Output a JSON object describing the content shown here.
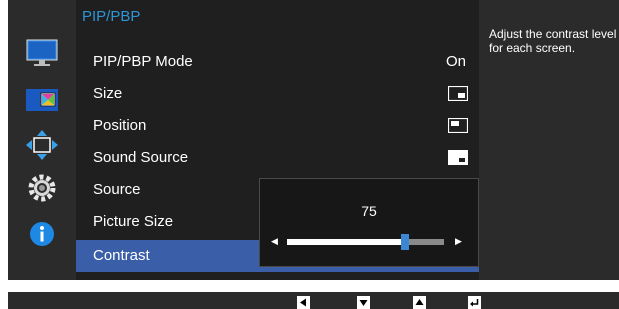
{
  "menu": {
    "title": "PIP/PBP",
    "items": [
      {
        "label": "PIP/PBP Mode",
        "value": "On",
        "icon": null
      },
      {
        "label": "Size",
        "value": "",
        "icon": "pip-size-icon"
      },
      {
        "label": "Position",
        "value": "",
        "icon": "pip-position-icon"
      },
      {
        "label": "Sound Source",
        "value": "",
        "icon": "pip-sound-source-icon"
      },
      {
        "label": "Source",
        "value": "",
        "icon": null
      },
      {
        "label": "Picture Size",
        "value": "",
        "icon": null
      },
      {
        "label": "Contrast",
        "value": "",
        "icon": null,
        "selected": true
      }
    ]
  },
  "popup": {
    "contrast_value": "75",
    "level": 75,
    "max": 100
  },
  "help": {
    "text": "Adjust the contrast level for each screen."
  },
  "sidebar": {
    "icons": [
      "monitor-icon",
      "pip-icon",
      "move-icon",
      "settings-icon",
      "info-icon"
    ],
    "active": "pip-icon"
  },
  "bottom_buttons": [
    "left-arrow-icon",
    "down-arrow-icon",
    "up-arrow-icon",
    "enter-icon"
  ],
  "colors": {
    "accent": "#2e95d6",
    "selected_row": "#3a5fa8",
    "slider_knob": "#3c86d4"
  }
}
